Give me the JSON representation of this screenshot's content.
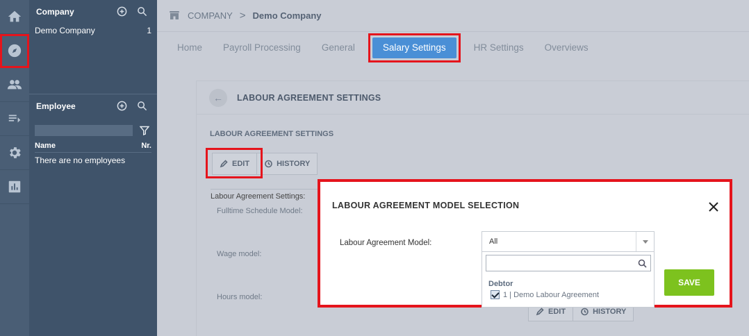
{
  "rail": {
    "items": [
      {
        "icon": "home-icon"
      },
      {
        "icon": "compass-icon",
        "active": true
      },
      {
        "icon": "people-icon"
      },
      {
        "icon": "list-icon"
      },
      {
        "icon": "gear-icon"
      },
      {
        "icon": "chart-icon"
      }
    ]
  },
  "company_panel": {
    "title": "Company",
    "rows": [
      {
        "name": "Demo Company",
        "count": "1"
      }
    ]
  },
  "employee_panel": {
    "title": "Employee",
    "columns": {
      "name": "Name",
      "nr": "Nr."
    },
    "empty_text": "There are no employees"
  },
  "breadcrumb": {
    "root": "COMPANY",
    "separator": ">",
    "current": "Demo Company"
  },
  "tabs": [
    {
      "label": "Home"
    },
    {
      "label": "Payroll Processing"
    },
    {
      "label": "General"
    },
    {
      "label": "Salary Settings",
      "active": true
    },
    {
      "label": "HR Settings"
    },
    {
      "label": "Overviews"
    }
  ],
  "card": {
    "title": "LABOUR AGREEMENT SETTINGS",
    "subtitle": "LABOUR AGREEMENT SETTINGS",
    "edit_label": "EDIT",
    "history_label": "HISTORY",
    "section_label": "Labour Agreement Settings:",
    "fields": [
      "Fulltime Schedule Model:",
      "Wage model:",
      "Hours model:"
    ],
    "bottom_edit_label": "EDIT",
    "bottom_history_label": "HISTORY"
  },
  "modal": {
    "title": "LABOUR AGREEMENT MODEL SELECTION",
    "field_label": "Labour Agreement Model:",
    "selected_value": "All",
    "search_placeholder": "",
    "group_label": "Debtor",
    "option_label": "1 | Demo Labour Agreement",
    "option_checked": true,
    "save_label": "SAVE"
  },
  "colors": {
    "highlight": "#e5141c",
    "tab_active": "#4a8fd6",
    "save_button": "#7dc21e",
    "sidebar": "#3f536a"
  }
}
